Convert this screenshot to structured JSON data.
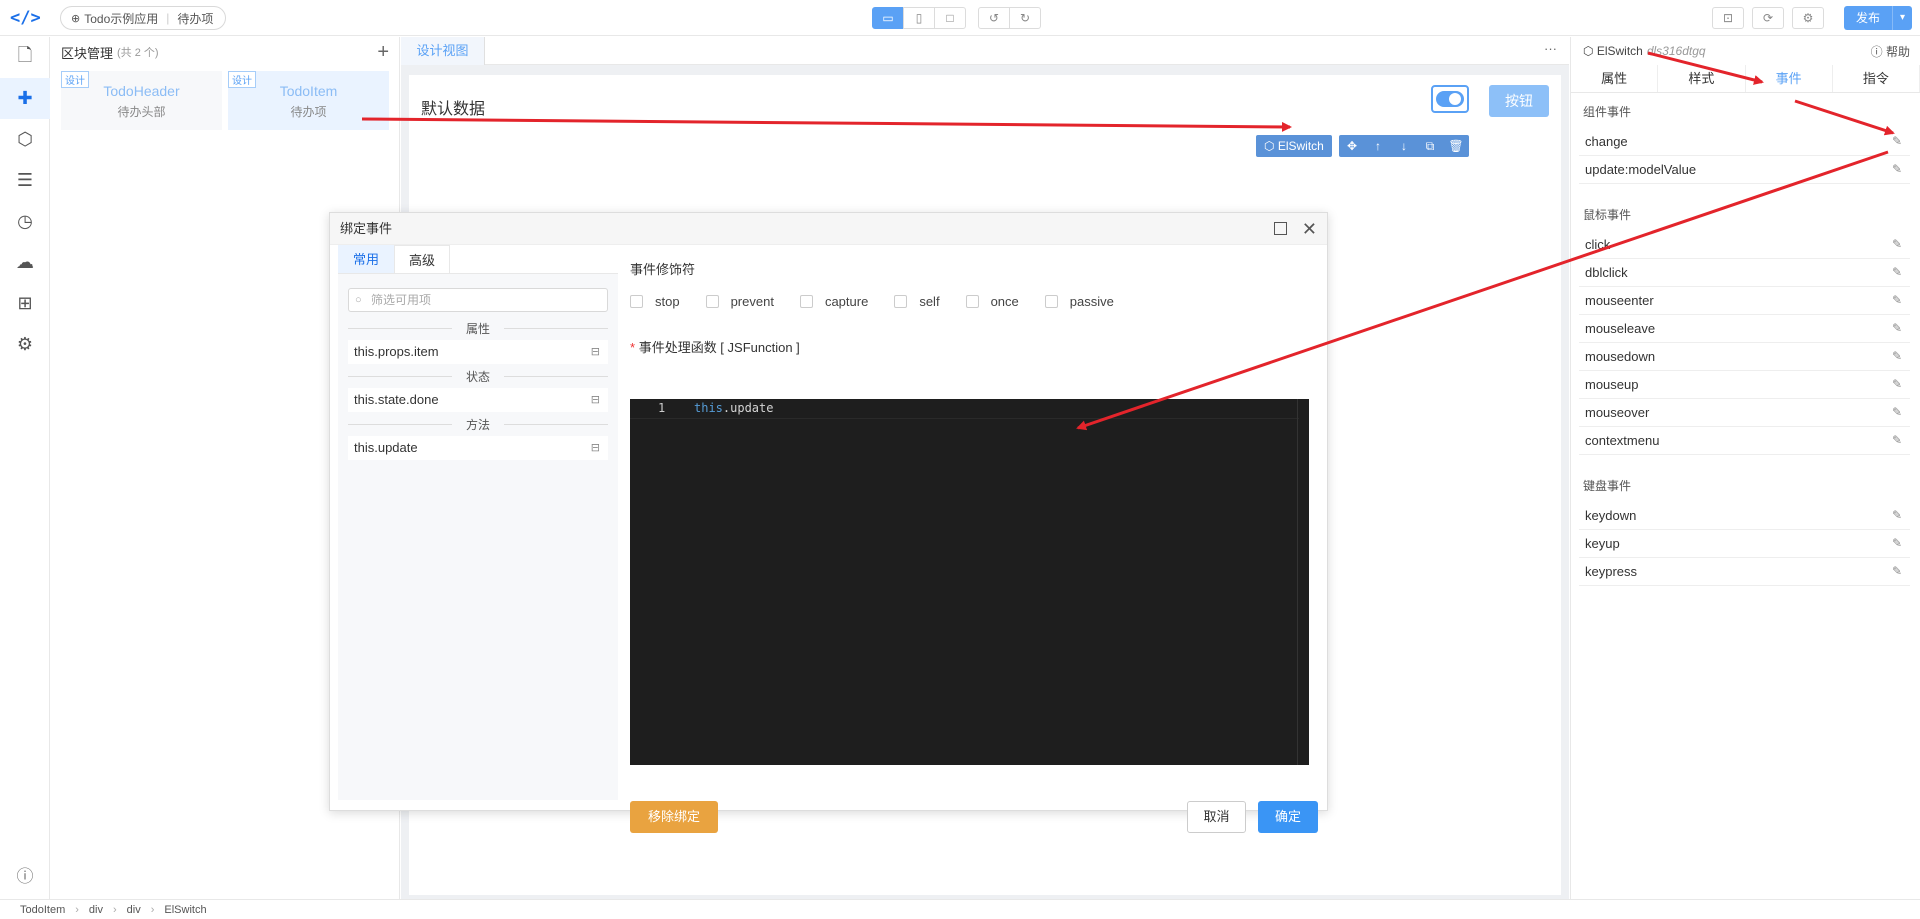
{
  "topbar": {
    "app_name": "Todo示例应用",
    "page_name": "待办项",
    "publish": "发布"
  },
  "blocks": {
    "title": "区块管理",
    "count": "(共 2 个)",
    "cards": [
      {
        "tag": "设计",
        "name": "TodoHeader",
        "desc": "待办头部"
      },
      {
        "tag": "设计",
        "name": "TodoItem",
        "desc": "待办项"
      }
    ]
  },
  "canvas": {
    "tab": "设计视图",
    "default_label": "默认数据",
    "button_label": "按钮",
    "selected_tag": "ElSwitch",
    "switch_on": true
  },
  "panel": {
    "component": "ElSwitch",
    "component_id": "dls316dtgq",
    "help": "帮助",
    "tabs": [
      "属性",
      "样式",
      "事件",
      "指令"
    ],
    "active_tab": "事件",
    "sections": [
      {
        "title": "组件事件",
        "events": [
          "change",
          "update:modelValue"
        ]
      },
      {
        "title": "鼠标事件",
        "events": [
          "click",
          "dblclick",
          "mouseenter",
          "mouseleave",
          "mousedown",
          "mouseup",
          "mouseover",
          "contextmenu"
        ]
      },
      {
        "title": "键盘事件",
        "events": [
          "keydown",
          "keyup",
          "keypress"
        ]
      }
    ]
  },
  "dialog": {
    "title": "绑定事件",
    "tabs": [
      "常用",
      "高级"
    ],
    "filter_placeholder": "筛选可用项",
    "groups": [
      {
        "title": "属性",
        "items": [
          "this.props.item"
        ]
      },
      {
        "title": "状态",
        "items": [
          "this.state.done"
        ]
      },
      {
        "title": "方法",
        "items": [
          "this.update"
        ]
      }
    ],
    "modifiers_label": "事件修饰符",
    "modifiers": [
      "stop",
      "prevent",
      "capture",
      "self",
      "once",
      "passive"
    ],
    "handler_required": "*",
    "handler_label": "事件处理函数 [ JSFunction ]",
    "code_line": "1",
    "code_kw": "this",
    "code_rest": ".update",
    "remove": "移除绑定",
    "cancel": "取消",
    "ok": "确定"
  },
  "breadcrumb": [
    "TodoItem",
    "div",
    "div",
    "ElSwitch"
  ],
  "colors": {
    "accent": "#5aa1f5",
    "annotation": "#e3242b",
    "remove": "#e9a340"
  }
}
